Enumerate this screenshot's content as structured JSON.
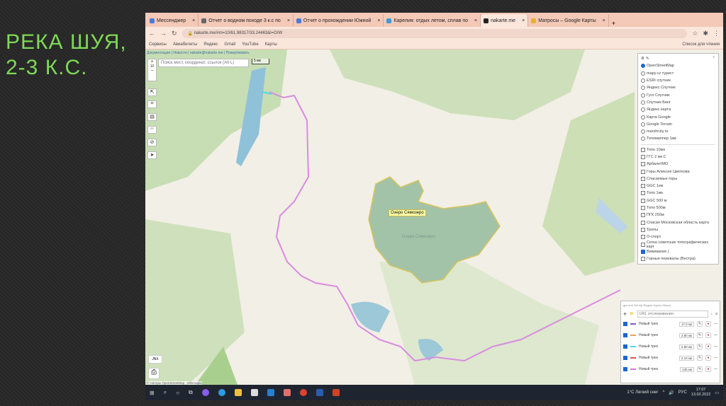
{
  "slide": {
    "title": "РЕКА ШУЯ, 2-3 К.С."
  },
  "browser": {
    "tabs": [
      {
        "label": "Мессенджер"
      },
      {
        "label": "Отчет о водном походе 3 к.с по"
      },
      {
        "label": "Отчет о прохождении Южной"
      },
      {
        "label": "Карелия: отдых летом, сплав по"
      },
      {
        "label": "nakarte.me",
        "active": true
      },
      {
        "label": "Матросы – Google Карты"
      }
    ],
    "url": "nakarte.me/#m=10/61.98317/33.24463&l=O/W",
    "bookmarks": [
      "Сервисы",
      "Авиабилеты",
      "Яндекс",
      "Gmail",
      "YouTube",
      "Карты"
    ],
    "reading_list": "Список для чтения"
  },
  "map": {
    "doc_links": "Документация | Новости | nakarte@nakarte.me | Пожертвовать",
    "search_placeholder": "Поиск мест, координат, ссылок (Alt-L)",
    "scale": "5 км",
    "zoom_level": "10",
    "lake_label": "Озеро Сямозеро",
    "lake_name": "Озеро Сямозеро",
    "jnx_label": "JNX",
    "attribution": "© Авторы OpenStreetMap , Wikimapia",
    "route_color": "#d98be0"
  },
  "layers": {
    "base": [
      {
        "label": "OpenStreetMap",
        "on": true
      },
      {
        "label": "mapy.cz турист"
      },
      {
        "label": "ESRI спутник"
      },
      {
        "label": "Яндекс Спутник"
      },
      {
        "label": "Гугл Спутник"
      },
      {
        "label": "Спутник Бинг"
      },
      {
        "label": "Яндекс карта"
      },
      {
        "label": "Карта Google"
      },
      {
        "label": "Google Terrain"
      },
      {
        "label": "marshruty.ru"
      },
      {
        "label": "Топомаппер 1км"
      }
    ],
    "overlays": [
      {
        "label": "Топо 10км"
      },
      {
        "label": "ГГС 2 км С"
      },
      {
        "label": "АрбалетMO"
      },
      {
        "label": "Горы Алексея Цветкова"
      },
      {
        "label": "Спасаемые горы"
      },
      {
        "label": "GGC 1км"
      },
      {
        "label": "Топо 1км"
      },
      {
        "label": "GGC 500 м"
      },
      {
        "label": "Топо 500м"
      },
      {
        "label": "ПГК 250м"
      },
      {
        "label": "Спасая Московская область карта"
      },
      {
        "label": "Тропы"
      },
      {
        "label": "О-спорт"
      },
      {
        "label": "Сетка советских топографических карт"
      },
      {
        "label": "Викимапия (",
        "on": true
      },
      {
        "label": "Горные перевалы (Вестра)"
      }
    ]
  },
  "tracks": {
    "header": "gpx kml Ozi zip Яндекс.Карты Strava",
    "url_placeholder": "URL отслеживания",
    "items": [
      {
        "name": "Новый трек",
        "color": "#7b5cc4",
        "length": "17.0 км"
      },
      {
        "name": "Новый трек",
        "color": "#f0a050",
        "length": "2.80 км"
      },
      {
        "name": "Новый трек",
        "color": "#4fd8e8",
        "length": "2.80 км"
      },
      {
        "name": "Новый трек",
        "color": "#e05050",
        "length": "2.10 км"
      },
      {
        "name": "Новый трек",
        "color": "#e070e0",
        "length": "135 км"
      }
    ]
  },
  "taskbar": {
    "weather": "1°C Легкий снег",
    "lang": "РУС",
    "time": "17:07",
    "date": "13.02.2022"
  }
}
